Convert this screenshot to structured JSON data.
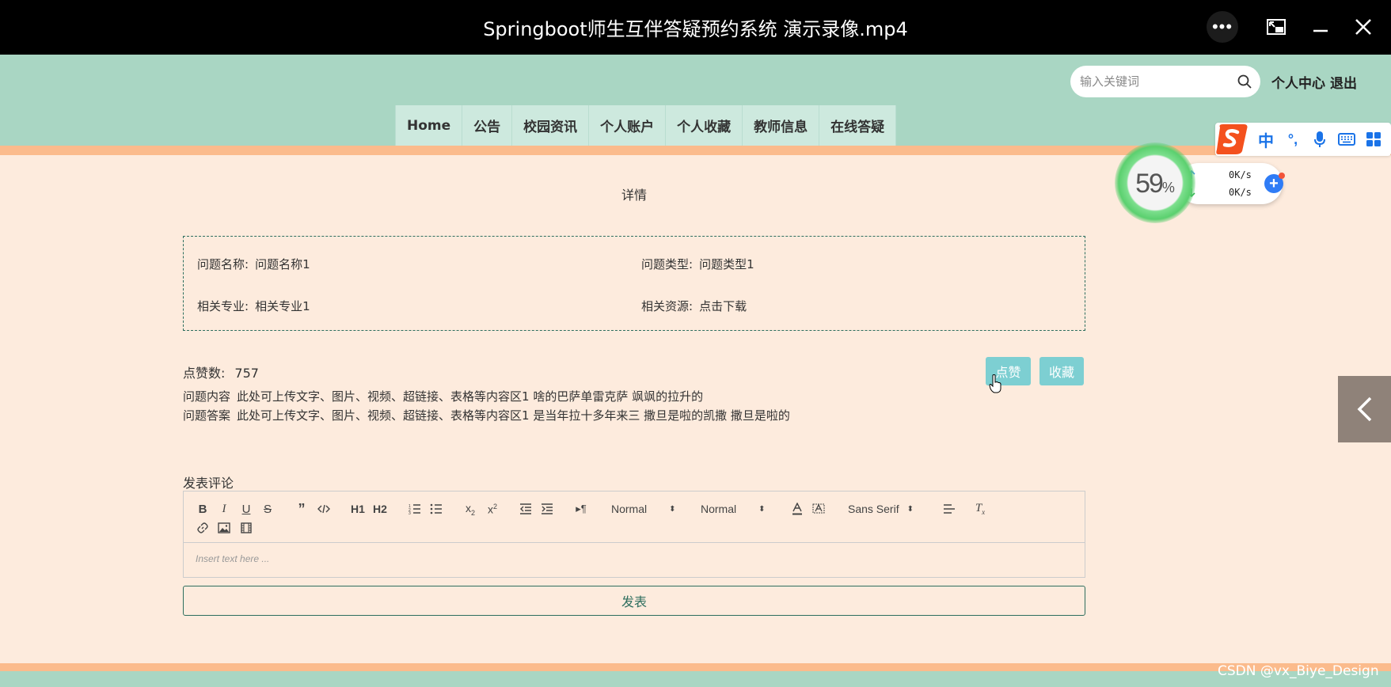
{
  "player": {
    "title": "Springboot师生互伴答疑预约系统 演示录像.mp4",
    "more_icon": "more-horizontal-icon",
    "pip_icon": "picture-in-picture-icon",
    "minimize_icon": "minimize-icon",
    "close_icon": "close-icon"
  },
  "header": {
    "search_placeholder": "输入关键词",
    "personal_center": "个人中心",
    "logout": "退出",
    "nav": [
      "Home",
      "公告",
      "校园资讯",
      "个人账户",
      "个人收藏",
      "教师信息",
      "在线答疑"
    ]
  },
  "detail": {
    "title": "详情",
    "fields": [
      {
        "label": "问题名称:",
        "value": "问题名称1"
      },
      {
        "label": "问题类型:",
        "value": "问题类型1"
      },
      {
        "label": "相关专业:",
        "value": "相关专业1"
      },
      {
        "label": "相关资源:",
        "value": "点击下载"
      }
    ],
    "like_label": "点赞数:",
    "like_count": "757",
    "like_button": "点赞",
    "favorite_button": "收藏",
    "question_label": "问题内容",
    "question_text": "此处可上传文字、图片、视频、超链接、表格等内容区1 啥的巴萨单雷克萨 飒飒的拉升的",
    "answer_label": "问题答案",
    "answer_text": "此处可上传文字、图片、视频、超链接、表格等内容区1 是当年拉十多年来三 撒旦是啦的凯撒 撒旦是啦的"
  },
  "comment": {
    "label": "发表评论",
    "toolbar": {
      "header_select": "Normal",
      "size_select": "Normal",
      "font_select": "Sans Serif",
      "h1": "H1",
      "h2": "H2"
    },
    "placeholder": "Insert text here ...",
    "submit": "发表"
  },
  "overlay": {
    "cpu_percent": "59",
    "upload_speed": "0K/s",
    "download_speed": "0K/s",
    "ime_lang": "中",
    "ime_punct": "°,"
  },
  "watermark": "CSDN @vx_Biye_Design",
  "colors": {
    "header_green": "#a9d6c3",
    "accent_orange": "#fbbb8c",
    "page_bg": "#fdebdd",
    "button_cyan": "#7dcfd2",
    "border_teal": "#2e6e5e"
  }
}
